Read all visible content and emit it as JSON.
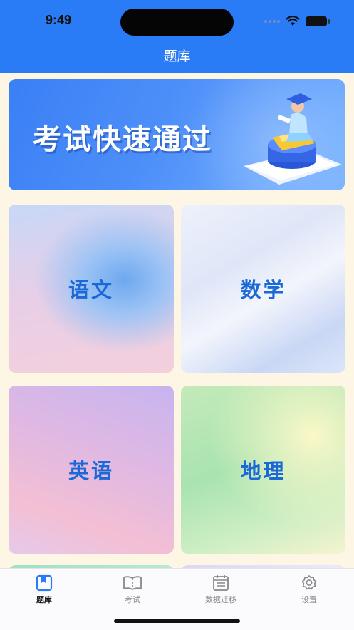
{
  "status_bar": {
    "time": "9:49"
  },
  "nav": {
    "title": "题库"
  },
  "banner": {
    "text": "考试快速通过"
  },
  "subjects": [
    {
      "label": "语文"
    },
    {
      "label": "数学"
    },
    {
      "label": "英语"
    },
    {
      "label": "地理"
    }
  ],
  "tabbar": {
    "items": [
      {
        "label": "题库",
        "icon": "question-bank-icon",
        "active": true
      },
      {
        "label": "考试",
        "icon": "open-book-icon",
        "active": false
      },
      {
        "label": "数据迁移",
        "icon": "calendar-list-icon",
        "active": false
      },
      {
        "label": "设置",
        "icon": "gear-icon",
        "active": false
      }
    ]
  },
  "colors": {
    "header": "#2a7bf6",
    "background": "#fdf6e4",
    "subject_text": "#1b68d8"
  }
}
